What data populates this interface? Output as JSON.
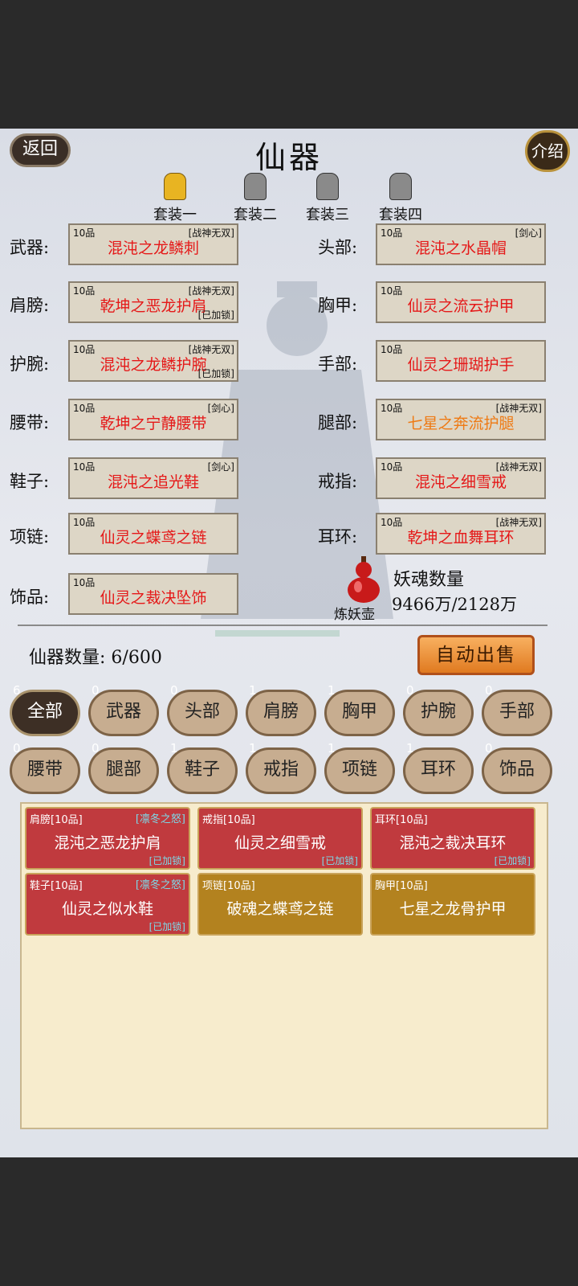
{
  "header": {
    "title": "仙器",
    "back_label": "返回",
    "info_label": "介绍"
  },
  "sets": [
    "套装一",
    "套装二",
    "套装三",
    "套装四"
  ],
  "slots_left": [
    {
      "label": "武器:",
      "grade": "10品",
      "tag": "[战神无双]",
      "name": "混沌之龙鳞刺",
      "lock": "",
      "color": "red"
    },
    {
      "label": "肩膀:",
      "grade": "10品",
      "tag": "[战神无双]",
      "name": "乾坤之恶龙护肩",
      "lock": "[已加锁]",
      "color": "red"
    },
    {
      "label": "护腕:",
      "grade": "10品",
      "tag": "[战神无双]",
      "name": "混沌之龙鳞护腕",
      "lock": "[已加锁]",
      "color": "red"
    },
    {
      "label": "腰带:",
      "grade": "10品",
      "tag": "[剑心]",
      "name": "乾坤之宁静腰带",
      "lock": "",
      "color": "red"
    },
    {
      "label": "鞋子:",
      "grade": "10品",
      "tag": "[剑心]",
      "name": "混沌之追光鞋",
      "lock": "",
      "color": "red"
    },
    {
      "label": "项链:",
      "grade": "10品",
      "tag": "",
      "name": "仙灵之蝶鸢之链",
      "lock": "",
      "color": "red"
    },
    {
      "label": "饰品:",
      "grade": "10品",
      "tag": "",
      "name": "仙灵之裁决坠饰",
      "lock": "",
      "color": "red"
    }
  ],
  "slots_right": [
    {
      "label": "头部:",
      "grade": "10品",
      "tag": "[剑心]",
      "name": "混沌之水晶帽",
      "lock": "",
      "color": "red"
    },
    {
      "label": "胸甲:",
      "grade": "10品",
      "tag": "",
      "name": "仙灵之流云护甲",
      "lock": "",
      "color": "red"
    },
    {
      "label": "手部:",
      "grade": "10品",
      "tag": "",
      "name": "仙灵之珊瑚护手",
      "lock": "",
      "color": "red"
    },
    {
      "label": "腿部:",
      "grade": "10品",
      "tag": "[战神无双]",
      "name": "七星之奔流护腿",
      "lock": "",
      "color": "orange"
    },
    {
      "label": "戒指:",
      "grade": "10品",
      "tag": "[战神无双]",
      "name": "混沌之细雪戒",
      "lock": "",
      "color": "red"
    },
    {
      "label": "耳环:",
      "grade": "10品",
      "tag": "[战神无双]",
      "name": "乾坤之血舞耳环",
      "lock": "",
      "color": "red"
    }
  ],
  "soul": {
    "pot_label": "炼妖壶",
    "title": "妖魂数量",
    "value": "9466万/2128万"
  },
  "inventory": {
    "count_label": "仙器数量:",
    "count_value": "6/600",
    "auto_sell": "自动出售"
  },
  "tabs": [
    {
      "label": "全部",
      "count": "6",
      "active": true
    },
    {
      "label": "武器",
      "count": "0"
    },
    {
      "label": "头部",
      "count": "0"
    },
    {
      "label": "肩膀",
      "count": "1"
    },
    {
      "label": "胸甲",
      "count": "1"
    },
    {
      "label": "护腕",
      "count": "0"
    },
    {
      "label": "手部",
      "count": "0"
    },
    {
      "label": "腰带",
      "count": "0"
    },
    {
      "label": "腿部",
      "count": "0"
    },
    {
      "label": "鞋子",
      "count": "1"
    },
    {
      "label": "戒指",
      "count": "1"
    },
    {
      "label": "项链",
      "count": "1"
    },
    {
      "label": "耳环",
      "count": "1"
    },
    {
      "label": "饰品",
      "count": "0"
    }
  ],
  "items": [
    {
      "header": "肩膀[10品]",
      "tag": "[凛冬之怒]",
      "name": "混沌之恶龙护肩",
      "lock": "[已加锁]",
      "style": "red"
    },
    {
      "header": "戒指[10品]",
      "tag": "",
      "name": "仙灵之细雪戒",
      "lock": "[已加锁]",
      "style": "red"
    },
    {
      "header": "耳环[10品]",
      "tag": "",
      "name": "混沌之裁决耳环",
      "lock": "[已加锁]",
      "style": "red"
    },
    {
      "header": "鞋子[10品]",
      "tag": "[凛冬之怒]",
      "name": "仙灵之似水鞋",
      "lock": "[已加锁]",
      "style": "red"
    },
    {
      "header": "项链[10品]",
      "tag": "",
      "name": "破魂之蝶鸢之链",
      "lock": "",
      "style": "gold"
    },
    {
      "header": "胸甲[10品]",
      "tag": "",
      "name": "七星之龙骨护甲",
      "lock": "",
      "style": "gold"
    }
  ],
  "colors": {
    "red_text": "#e51818",
    "orange_text": "#ee7a14",
    "card_red": "#c03a3e",
    "card_gold": "#b3821f"
  }
}
